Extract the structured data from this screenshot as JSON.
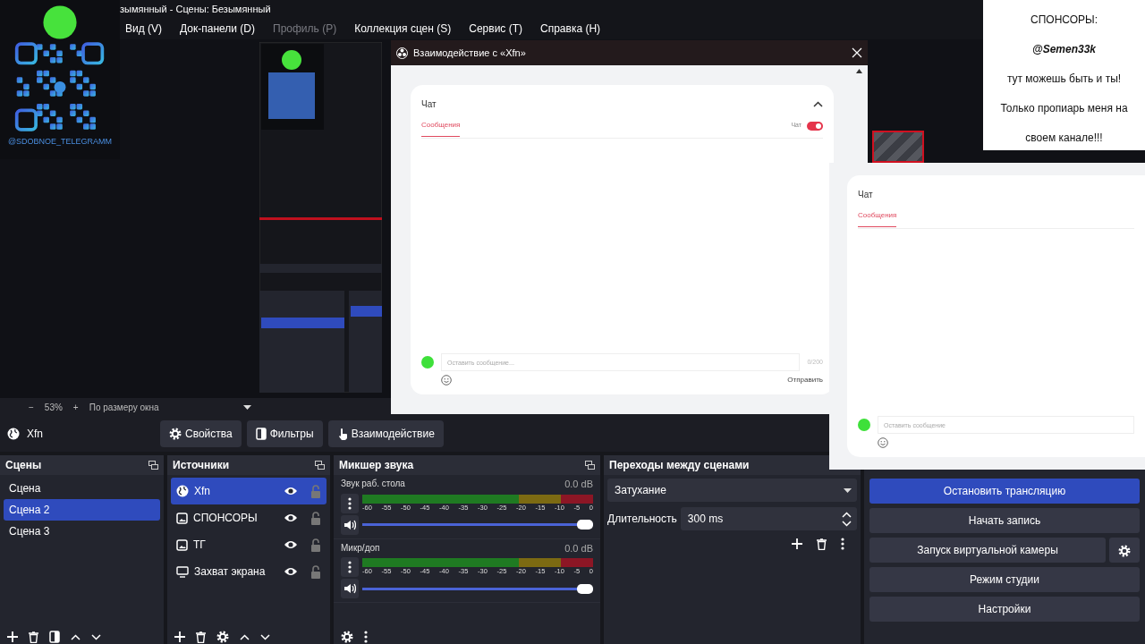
{
  "title_bar": {
    "title": "зымянный - Сцены: Безымянный"
  },
  "menu": [
    {
      "label": "Вид (V)",
      "disabled": false
    },
    {
      "label": "Док-панели (D)",
      "disabled": false
    },
    {
      "label": "Профиль (P)",
      "disabled": true
    },
    {
      "label": "Коллекция сцен (S)",
      "disabled": false
    },
    {
      "label": "Сервис (T)",
      "disabled": false
    },
    {
      "label": "Справка (H)",
      "disabled": false
    }
  ],
  "qr_overlay": {
    "handle": "@SDOBNOE_TELEGRAMM"
  },
  "sponsors_overlay": {
    "lines": [
      {
        "text": "СПОНСОРЫ:",
        "emphasis": false
      },
      {
        "text": "@Semen33k",
        "emphasis": true
      },
      {
        "text": "тут можешь быть и ты!",
        "emphasis": false
      },
      {
        "text": "Только пропиарь меня на своем канале!!!",
        "emphasis": false
      }
    ]
  },
  "preview_chat": {
    "title": "Чат",
    "tab": "Сообщения",
    "placeholder": "Оставить сообщение"
  },
  "dialog": {
    "title": "Взаимодействие с «Xfn»",
    "chat": {
      "title": "Чат",
      "tab": "Сообщения",
      "toggle_label": "Чат",
      "toggle_on": true,
      "placeholder": "Оставить сообщение...",
      "counter": "0/200",
      "send": "Отправить"
    }
  },
  "zoom_bar": {
    "zoom_out": "−",
    "zoom": "53%",
    "zoom_in": "+",
    "fit": "По размеру окна"
  },
  "source_toolbar": {
    "source": "Xfn",
    "buttons": [
      {
        "label": "Свойства",
        "kind": "properties"
      },
      {
        "label": "Фильтры",
        "kind": "filters"
      },
      {
        "label": "Взаимодействие",
        "kind": "interact"
      }
    ]
  },
  "scenes": {
    "title": "Сцены",
    "items": [
      {
        "name": "Сцена",
        "selected": false
      },
      {
        "name": "Сцена 2",
        "selected": true
      },
      {
        "name": "Сцена 3",
        "selected": false
      }
    ]
  },
  "sources": {
    "title": "Источники",
    "items": [
      {
        "name": "Xfn",
        "kind": "browser",
        "selected": true,
        "visible": true,
        "locked": false
      },
      {
        "name": "СПОНСОРЫ",
        "kind": "image",
        "selected": false,
        "visible": true,
        "locked": false
      },
      {
        "name": "ТГ",
        "kind": "image",
        "selected": false,
        "visible": true,
        "locked": false
      },
      {
        "name": "Захват экрана",
        "kind": "display",
        "selected": false,
        "visible": true,
        "locked": false
      }
    ]
  },
  "mixer": {
    "title": "Микшер звука",
    "channels": [
      {
        "name": "Звук раб. стола",
        "reading": "0.0 dB",
        "level": 1,
        "scale": [
          "-60",
          "-55",
          "-50",
          "-45",
          "-40",
          "-35",
          "-30",
          "-25",
          "-20",
          "-15",
          "-10",
          "-5",
          "0"
        ]
      },
      {
        "name": "Микр/доп",
        "reading": "0.0 dB",
        "level": 1,
        "scale": [
          "-60",
          "-55",
          "-50",
          "-45",
          "-40",
          "-35",
          "-30",
          "-25",
          "-20",
          "-15",
          "-10",
          "-5",
          "0"
        ]
      }
    ]
  },
  "transitions": {
    "title": "Переходы между сценами",
    "transition": "Затухание",
    "duration_label": "Длительность",
    "duration": "300 ms"
  },
  "controls": {
    "buttons": [
      {
        "label": "Остановить трансляцию",
        "active": true,
        "settings": false
      },
      {
        "label": "Начать запись",
        "active": false,
        "settings": false
      },
      {
        "label": "Запуск виртуальной камеры",
        "active": false,
        "settings": true
      },
      {
        "label": "Режим студии",
        "active": false,
        "settings": false
      },
      {
        "label": "Настройки",
        "active": false,
        "settings": false
      }
    ]
  }
}
